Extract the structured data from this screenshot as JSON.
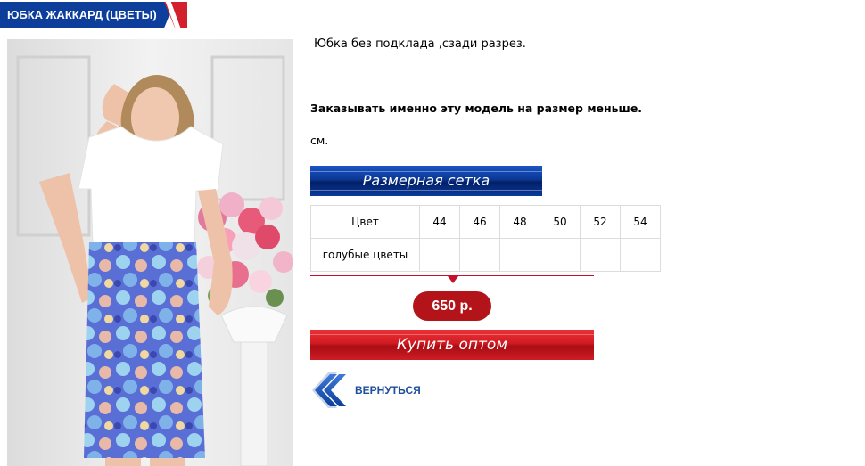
{
  "product": {
    "title": "ЮБКА ЖАККАРД (ЦВЕТЫ)",
    "description": "Юбка без подклада ,сзади разрез.",
    "size_advice": "Заказывать именно эту модель на размер меньше.",
    "measure_note": "см.",
    "price": "650 р."
  },
  "size_chart": {
    "banner_label": "Размерная сетка",
    "header_label": "Цвет",
    "sizes": [
      "44",
      "46",
      "48",
      "50",
      "52",
      "54"
    ],
    "rows": [
      {
        "color": "голубые цветы",
        "cells": [
          "",
          "",
          "",
          "",
          "",
          ""
        ]
      }
    ]
  },
  "actions": {
    "buy_label": "Купить оптом",
    "back_label": "ВЕРНУТЬСЯ"
  },
  "colors": {
    "brand_blue": "#0d3e9b",
    "brand_red": "#d2202d",
    "price_red": "#b3141a"
  },
  "icons": {
    "back": "double-chevron-left-icon"
  }
}
